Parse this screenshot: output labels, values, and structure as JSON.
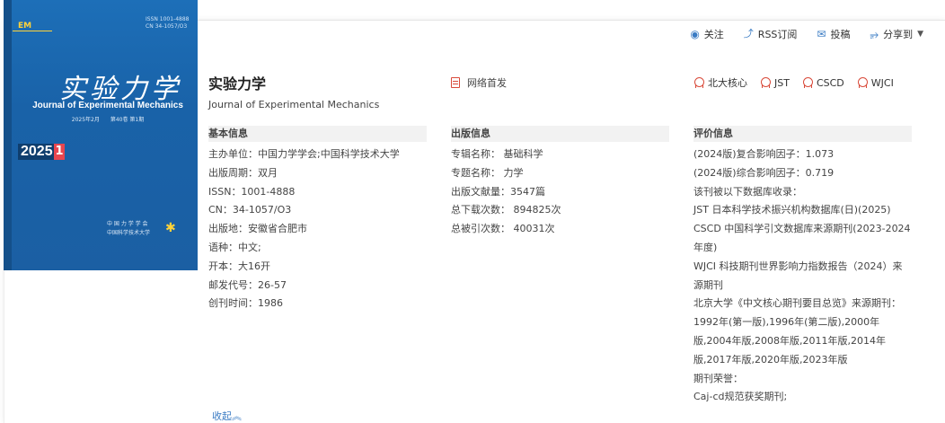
{
  "cover": {
    "issn_line1": "ISSN 1001-4888",
    "issn_line2": "CN 34-1057/O3",
    "cn_title": "实验力学",
    "en_title": "Journal of Experimental Mechanics",
    "issue": "2025年2月　　第40卷 第1期",
    "year": "2025",
    "issue_no": "1",
    "publisher1": "中 国 力 学 学 会",
    "publisher2": "中国科学技术大学"
  },
  "toolbar": {
    "follow": "关注",
    "rss": "RSS订阅",
    "submit": "投稿",
    "share": "分享到"
  },
  "journal": {
    "title": "实验力学",
    "en_title": "Journal of Experimental Mechanics",
    "online_first": "网络首发"
  },
  "badges": [
    "北大核心",
    "JST",
    "CSCD",
    "WJCI"
  ],
  "basic": {
    "heading": "基本信息",
    "rows": [
      "主办单位：中国力学学会;中国科学技术大学",
      "出版周期：双月",
      "ISSN：1001-4888",
      "CN：34-1057/O3",
      "出版地：安徽省合肥市",
      "语种：中文;",
      "开本：大16开",
      "邮发代号：26-57",
      "创刊时间：1986"
    ]
  },
  "publish": {
    "heading": "出版信息",
    "rows": [
      "专辑名称：  基础科学",
      "专题名称：  力学",
      "出版文献量：3547篇",
      "总下载次数：  894825次",
      "总被引次数：  40031次"
    ]
  },
  "eval": {
    "heading": "评价信息",
    "rows": [
      "(2024版)复合影响因子：1.073",
      "(2024版)综合影响因子：0.719",
      "该刊被以下数据库收录：",
      "JST 日本科学技术振兴机构数据库(日)(2025)",
      "CSCD 中国科学引文数据库来源期刊(2023-2024年度)",
      "WJCI 科技期刊世界影响力指数报告（2024）来源期刊",
      "北京大学《中文核心期刊要目总览》来源期刊：",
      "1992年(第一版),1996年(第二版),2000年版,2004年版,2008年版,2011年版,2014年版,2017年版,2020年版,2023年版",
      "期刊荣誉：",
      "Caj-cd规范获奖期刊;"
    ]
  },
  "collapse_label": "收起︽"
}
